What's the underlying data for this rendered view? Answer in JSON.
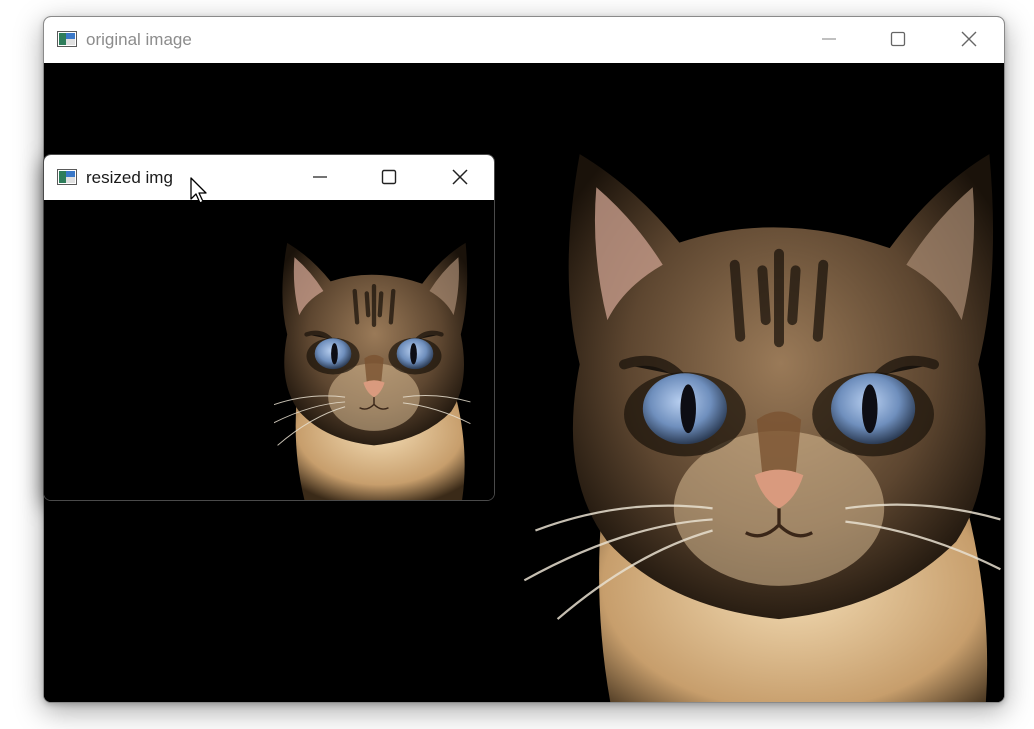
{
  "windows": {
    "original": {
      "title": "original image",
      "buttons": [
        "minimize-icon",
        "maximize-icon",
        "close-icon"
      ],
      "content": "cat photograph (full size)"
    },
    "resized": {
      "title": "resized img",
      "buttons": [
        "minimize-icon",
        "maximize-icon",
        "close-icon"
      ],
      "content": "cat photograph (scaled down)"
    }
  },
  "colors": {
    "titlebar_bg": "#ffffff",
    "inactive_title": "#8c8c8c",
    "active_title": "#1a1a1a",
    "canvas_bg": "#000000"
  }
}
